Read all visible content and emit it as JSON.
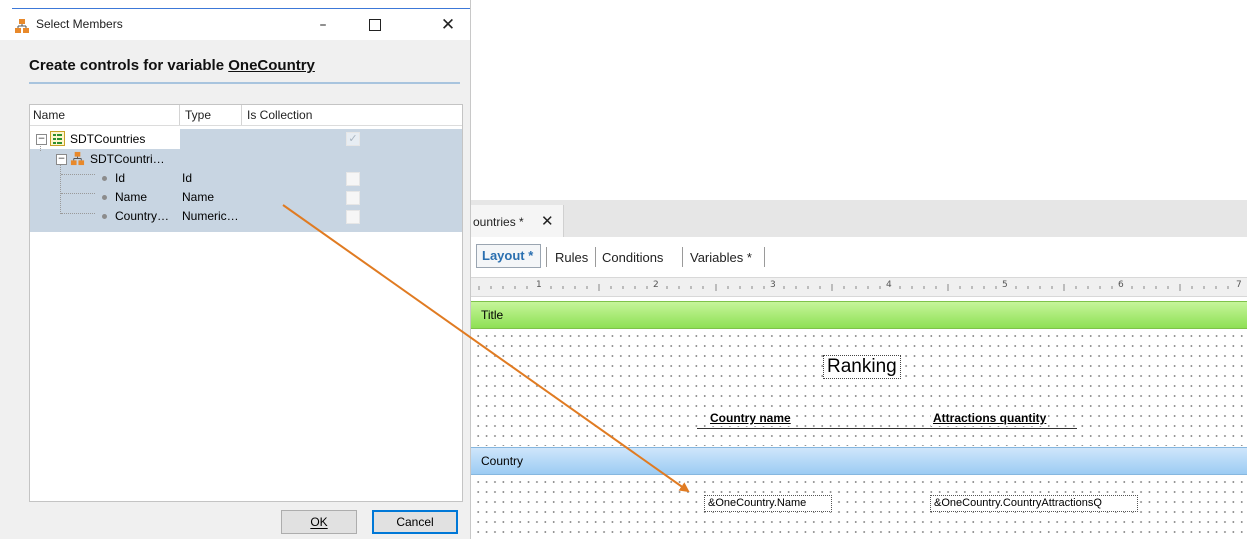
{
  "dialog": {
    "title": "Select Members",
    "heading_prefix": "Create controls for variable ",
    "heading_var": "OneCountry",
    "columns": [
      "Name",
      "Type",
      "Is Collection"
    ],
    "rows": [
      {
        "name": "SDTCountries",
        "type": "",
        "is_collection": true
      },
      {
        "name": "SDTCountri…",
        "type": "",
        "is_collection": null
      },
      {
        "name": "Id",
        "type": "Id",
        "is_collection": false
      },
      {
        "name": "Name",
        "type": "Name",
        "is_collection": false
      },
      {
        "name": "Country…",
        "type": "Numeric…",
        "is_collection": false
      }
    ],
    "ok_label": "OK",
    "cancel_label": "Cancel",
    "minimize": "–",
    "close": "✕"
  },
  "designer": {
    "doc_tab": "ountries *",
    "doc_tab_close": "✕",
    "subtabs": [
      "Layout *",
      "Rules",
      "Conditions",
      "Variables *"
    ],
    "ruler_numbers": [
      "1",
      "2",
      "3",
      "4",
      "5",
      "6",
      "7"
    ],
    "bands": {
      "title": "Title",
      "country": "Country"
    },
    "controls": {
      "ranking": "Ranking",
      "col_country_name": "Country name",
      "col_attractions": "Attractions quantity",
      "var_name": "&OneCountry.Name",
      "var_attractions": "&OneCountry.CountryAttractionsQ"
    }
  },
  "colors": {
    "title_band": "#a6e86f",
    "country_band": "#b7daf7",
    "selection": "#c8d5e2",
    "arrow": "#e07b22",
    "accent": "#0078d7"
  },
  "icons": [
    "sdt-icon",
    "structure-icon",
    "attribute-dot-icon"
  ]
}
